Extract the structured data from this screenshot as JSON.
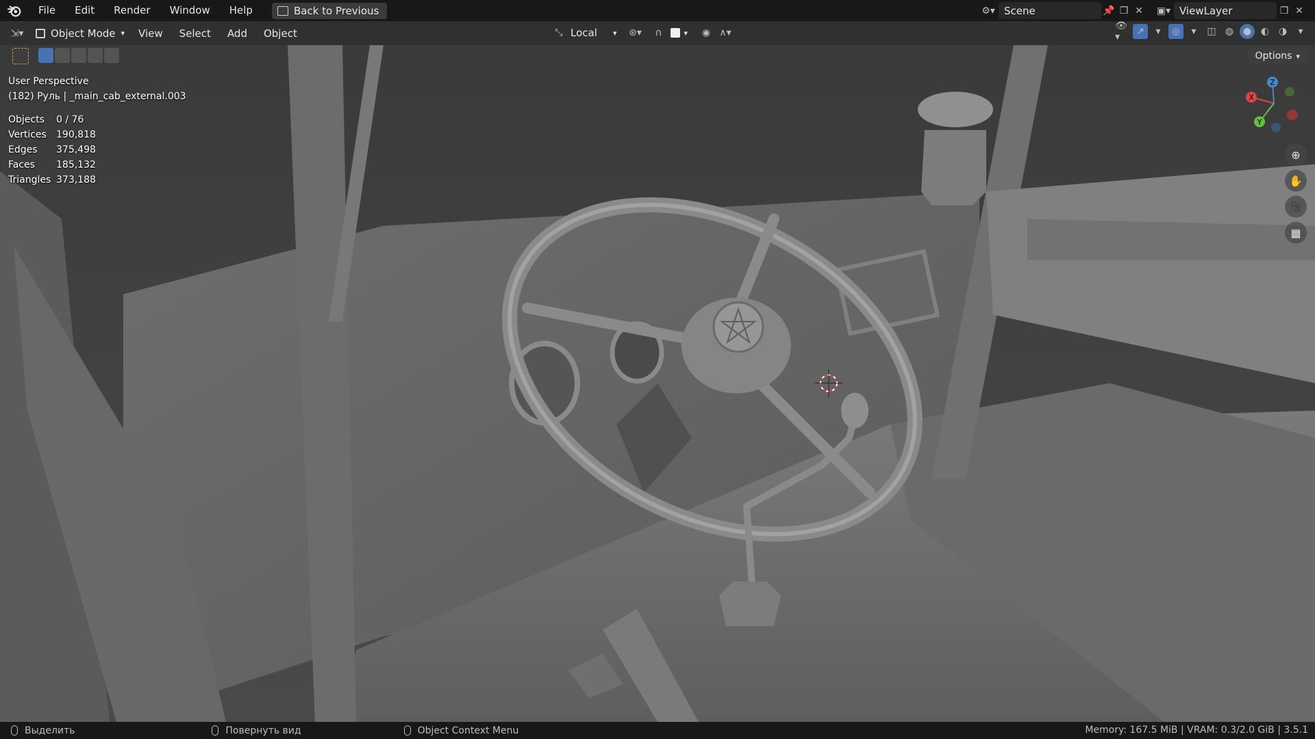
{
  "menubar": {
    "items": [
      "File",
      "Edit",
      "Render",
      "Window",
      "Help"
    ],
    "back_button": "Back to Previous",
    "scene": "Scene",
    "view_layer": "ViewLayer"
  },
  "header": {
    "mode": "Object Mode",
    "menus": [
      "View",
      "Select",
      "Add",
      "Object"
    ],
    "transform_orientation": "Local"
  },
  "viewport": {
    "view_name": "User Perspective",
    "active_object": "(182) Руль | _main_cab_external.003",
    "stats": [
      {
        "label": "Objects",
        "value": "0 / 76"
      },
      {
        "label": "Vertices",
        "value": "190,818"
      },
      {
        "label": "Edges",
        "value": "375,498"
      },
      {
        "label": "Faces",
        "value": "185,132"
      },
      {
        "label": "Triangles",
        "value": "373,188"
      }
    ],
    "options_label": "Options",
    "gizmo": {
      "x": "X",
      "y": "Y",
      "z": "Z"
    }
  },
  "statusbar": {
    "left_click": "Выделить",
    "middle_click": "Повернуть вид",
    "right_click": "Object Context Menu",
    "memory": "Memory: 167.5 MiB | VRAM: 0.3/2.0 GiB | 3.5.1"
  }
}
